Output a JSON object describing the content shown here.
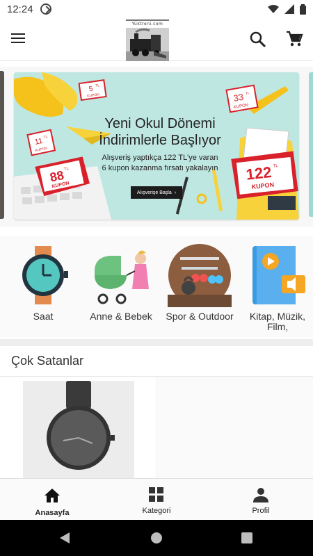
{
  "status_bar": {
    "time": "12:24"
  },
  "header": {
    "logo_text": "Yüktreni.com"
  },
  "banner": {
    "title_line1": "Yeni Okul Dönemi",
    "title_line2": "İndirimlerle Başlıyor",
    "subtitle_line1": "Alışveriş yaptıkça 122 TL'ye varan",
    "subtitle_line2": "6 kupon kazanma fırsatı yakalayın",
    "cta_label": "Alışverişe Başla",
    "coupons": {
      "c5": {
        "amount": "5",
        "unit": "TL",
        "label": "KUPON"
      },
      "c11": {
        "amount": "11",
        "unit": "TL",
        "label": "KUPON"
      },
      "c33": {
        "amount": "33",
        "unit": "TL",
        "label": "KUPON"
      },
      "c88": {
        "amount": "88",
        "unit": "TL",
        "label": "KUPON"
      },
      "c122": {
        "amount": "122",
        "unit": "TL",
        "label": "KUPON"
      }
    }
  },
  "categories": [
    {
      "label": "Saat",
      "icon": "watch-icon"
    },
    {
      "label": "Anne & Bebek",
      "icon": "stroller-icon"
    },
    {
      "label": "Spor & Outdoor",
      "icon": "dumbbell-icon"
    },
    {
      "label": "Kitap, Müzik, Film,",
      "icon": "book-icon"
    }
  ],
  "best_sellers": {
    "title": "Çok Satanlar"
  },
  "bottom_nav": {
    "items": [
      {
        "label": "Anasayfa",
        "icon": "home-icon",
        "active": true
      },
      {
        "label": "Kategori",
        "icon": "grid-icon",
        "active": false
      },
      {
        "label": "Profil",
        "icon": "person-icon",
        "active": false
      }
    ]
  },
  "colors": {
    "banner_bg": "#bfe7e2",
    "coupon_red": "#d8212b",
    "accent_yellow": "#f7d23a"
  }
}
